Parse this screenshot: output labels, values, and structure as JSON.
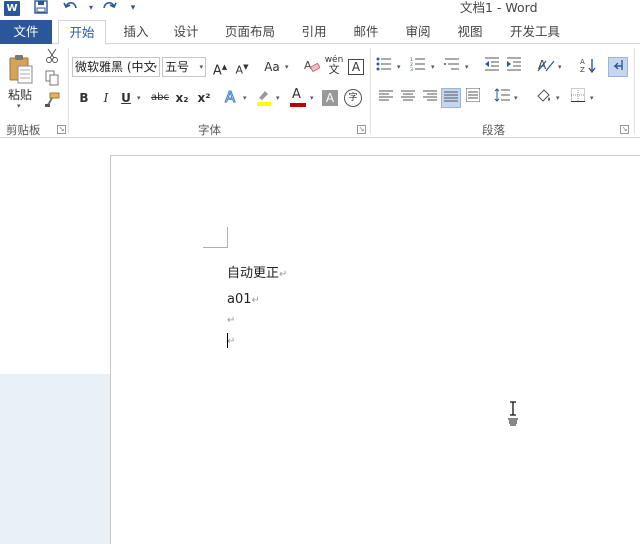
{
  "window": {
    "title": "文档1 - Word",
    "app_icon_letter": "W"
  },
  "quick_access": {
    "save_icon": "save-icon",
    "undo_icon": "undo-icon",
    "redo_icon": "redo-icon",
    "customize_icon": "customize-icon"
  },
  "tabs": {
    "file": "文件",
    "home": "开始",
    "insert": "插入",
    "design": "设计",
    "layout": "页面布局",
    "references": "引用",
    "mailings": "邮件",
    "review": "审阅",
    "view": "视图",
    "developer": "开发工具"
  },
  "ribbon": {
    "clipboard": {
      "label": "剪贴板",
      "paste_label": "粘贴"
    },
    "font": {
      "label": "字体",
      "font_name": "微软雅黑 (中文",
      "font_size": "五号",
      "bold": "B",
      "italic": "I",
      "underline": "U",
      "strikethrough": "abc",
      "subscript": "x₂",
      "superscript": "x²",
      "grow": "A",
      "shrink": "A",
      "change_case": "Aa",
      "phonetic_top": "wén",
      "phonetic_bottom": "文",
      "char_border": "A",
      "font_color_letter": "A",
      "char_shading": "A",
      "enclose_char": "字",
      "highlight_color": "#ffff00",
      "font_color": "#c00000"
    },
    "paragraph": {
      "label": "段落"
    }
  },
  "document": {
    "lines": [
      "自动更正",
      "a01",
      "",
      ""
    ],
    "pilcrow": "↵"
  }
}
